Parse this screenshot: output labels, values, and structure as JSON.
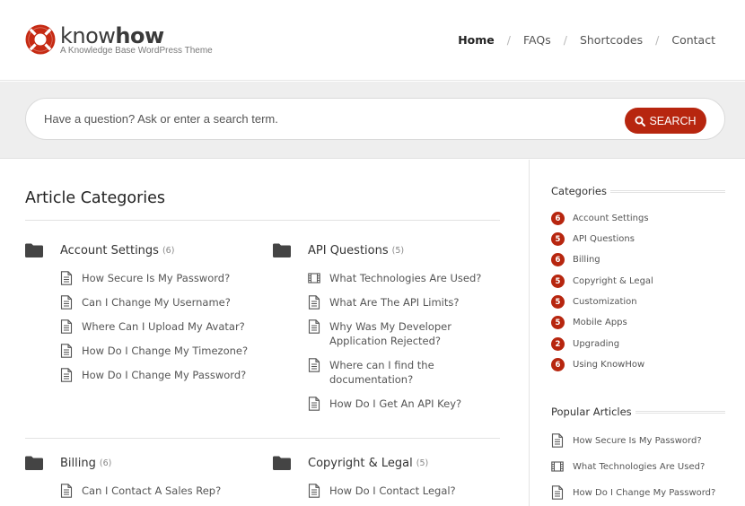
{
  "brand": {
    "name_light": "know",
    "name_bold": "how",
    "tagline": "A Knowledge Base WordPress Theme"
  },
  "nav": {
    "home": "Home",
    "faqs": "FAQs",
    "shortcodes": "Shortcodes",
    "contact": "Contact",
    "separator": "/"
  },
  "search": {
    "placeholder": "Have a question? Ask or enter a search term.",
    "button_label": "SEARCH"
  },
  "main": {
    "title": "Article Categories",
    "categories": [
      {
        "name": "Account Settings",
        "count": "(6)",
        "articles": [
          {
            "title": "How Secure Is My Password?",
            "icon": "document-icon"
          },
          {
            "title": "Can I Change My Username?",
            "icon": "document-icon"
          },
          {
            "title": "Where Can I Upload My Avatar?",
            "icon": "document-icon"
          },
          {
            "title": "How Do I Change My Timezone?",
            "icon": "document-icon"
          },
          {
            "title": "How Do I Change My Password?",
            "icon": "document-icon"
          }
        ]
      },
      {
        "name": "API Questions",
        "count": "(5)",
        "articles": [
          {
            "title": "What Technologies Are Used?",
            "icon": "video-icon"
          },
          {
            "title": "What Are The API Limits?",
            "icon": "document-icon"
          },
          {
            "title_line1": "Why Was My Developer",
            "title_line2": "Application Rejected?",
            "icon": "document-icon"
          },
          {
            "title_line1": "Where can I find the",
            "title_line2": "documentation?",
            "icon": "document-icon"
          },
          {
            "title": "How Do I Get An API Key?",
            "icon": "document-icon"
          }
        ]
      },
      {
        "name": "Billing",
        "count": "(6)",
        "articles": [
          {
            "title": "Can I Contact A Sales Rep?",
            "icon": "document-icon"
          }
        ]
      },
      {
        "name": "Copyright & Legal",
        "count": "(5)",
        "articles": [
          {
            "title": "How Do I Contact Legal?",
            "icon": "document-icon"
          }
        ]
      }
    ]
  },
  "sidebar": {
    "categories_title": "Categories",
    "categories": [
      {
        "count": "6",
        "name": "Account Settings"
      },
      {
        "count": "5",
        "name": "API Questions"
      },
      {
        "count": "6",
        "name": "Billing"
      },
      {
        "count": "5",
        "name": "Copyright & Legal"
      },
      {
        "count": "5",
        "name": "Customization"
      },
      {
        "count": "5",
        "name": "Mobile Apps"
      },
      {
        "count": "2",
        "name": "Upgrading"
      },
      {
        "count": "6",
        "name": "Using KnowHow"
      }
    ],
    "popular_title": "Popular Articles",
    "popular": [
      {
        "title": "How Secure Is My Password?",
        "icon": "document-icon"
      },
      {
        "title": "What Technologies Are Used?",
        "icon": "video-icon"
      },
      {
        "title": "How Do I Change My Password?",
        "icon": "document-icon"
      }
    ]
  },
  "colors": {
    "accent": "#b7260f",
    "search_band": "#eeeeee"
  }
}
